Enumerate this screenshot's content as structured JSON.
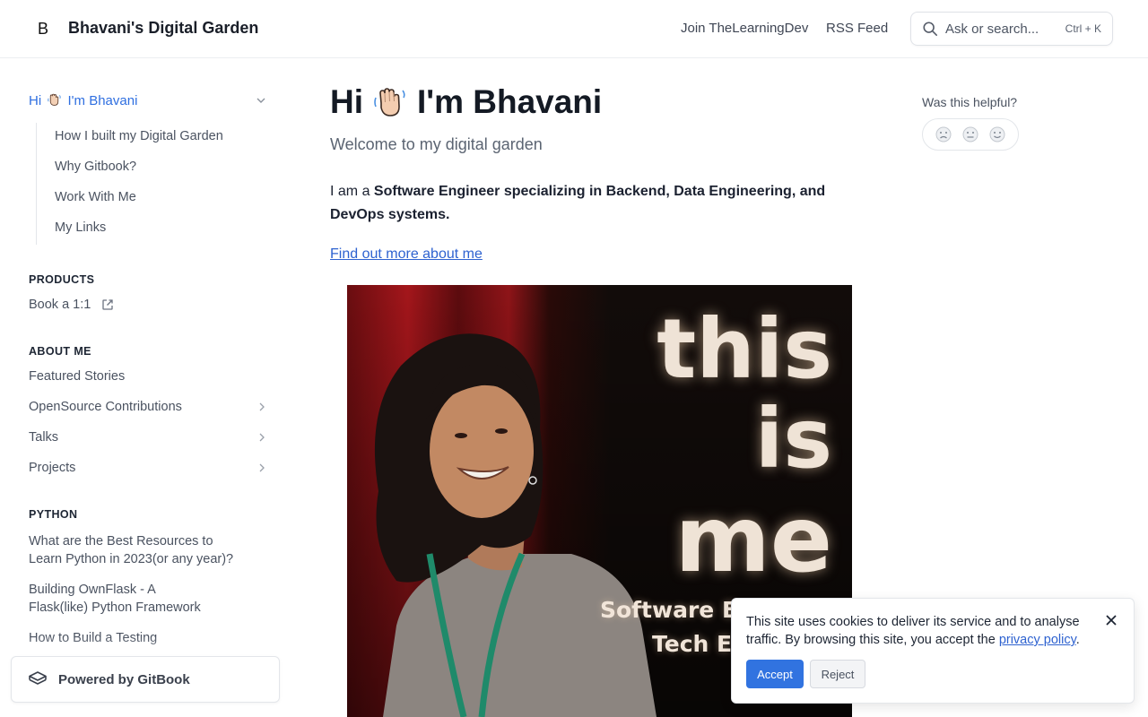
{
  "header": {
    "logo_letter": "B",
    "site_title": "Bhavani's Digital Garden",
    "nav": [
      "Join TheLearningDev",
      "RSS Feed"
    ],
    "search": {
      "placeholder": "Ask or search...",
      "shortcut": "Ctrl + K"
    }
  },
  "sidebar": {
    "active_page": "I'm Bhavani",
    "active_page_prefix": "Hi",
    "sub_items": [
      "How I built my Digital Garden",
      "Why Gitbook?",
      "Work With Me",
      "My Links"
    ],
    "sections": [
      {
        "title": "PRODUCTS",
        "items": [
          {
            "label": "Book a 1:1",
            "icon": "external-link-icon"
          }
        ]
      },
      {
        "title": "ABOUT ME",
        "items": [
          {
            "label": "Featured Stories"
          },
          {
            "label": "OpenSource Contributions",
            "icon": "chevron-right-icon"
          },
          {
            "label": "Talks",
            "icon": "chevron-right-icon"
          },
          {
            "label": "Projects",
            "icon": "chevron-right-icon"
          }
        ]
      },
      {
        "title": "PYTHON",
        "items": [
          {
            "label": "What are the Best Resources to Learn Python in 2023(or any year)?"
          },
          {
            "label": "Building OwnFlask - A Flask(like) Python Framework"
          },
          {
            "label": "How to Build a Testing"
          }
        ]
      }
    ],
    "powered_by": "Powered by GitBook"
  },
  "main": {
    "title_prefix": "Hi",
    "title": "I'm Bhavani",
    "subtitle": "Welcome to my digital garden",
    "intro_lead": "I am a",
    "intro_bold": "Software Engineer specializing in Backend, Data Engineering, and DevOps systems.",
    "link": "Find out more about me",
    "image": {
      "word1": "this",
      "word2": "is",
      "word3": "me",
      "caption_line1": "Software E",
      "caption_line2": "Tech E"
    }
  },
  "helpful": {
    "label": "Was this helpful?",
    "options": [
      "sad-face-icon",
      "neutral-face-icon",
      "happy-face-icon"
    ]
  },
  "cookie": {
    "text_before": "This site uses cookies to deliver its service and to analyse traffic. By browsing this site, you accept the",
    "link": "privacy policy",
    "text_after": ".",
    "accept": "Accept",
    "reject": "Reject"
  },
  "colors": {
    "accent": "#2f6fe0",
    "accept_button": "#3173e0"
  }
}
